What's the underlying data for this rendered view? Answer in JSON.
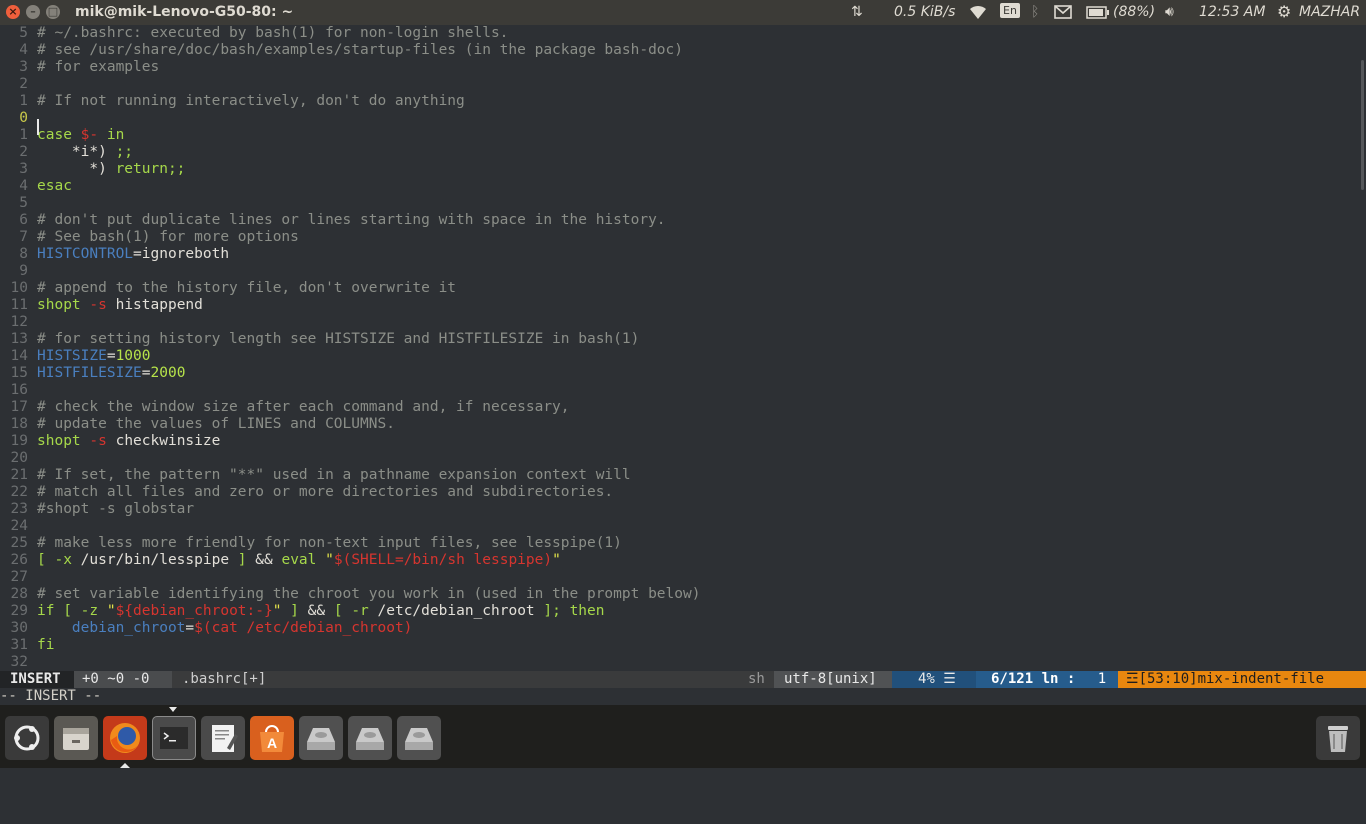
{
  "topbar": {
    "title": "mik@mik-Lenovo-G50-80: ~",
    "net_speed": "0.5 KiB/s",
    "keyboard": "En",
    "battery": "(88%)",
    "time": "12:53 AM",
    "user": "MAZHAR"
  },
  "editor": {
    "lines": [
      {
        "num": "5",
        "segs": [
          [
            "c",
            "# ~/.bashrc: executed by bash(1) for non-login shells."
          ]
        ]
      },
      {
        "num": "4",
        "segs": [
          [
            "c",
            "# see /usr/share/doc/bash/examples/startup-files (in the package bash-doc)"
          ]
        ]
      },
      {
        "num": "3",
        "segs": [
          [
            "c",
            "# for examples"
          ]
        ]
      },
      {
        "num": "2",
        "segs": []
      },
      {
        "num": "1",
        "segs": [
          [
            "c",
            "# If not running interactively, don't do anything"
          ]
        ]
      },
      {
        "num": "0",
        "cur": true,
        "segs": []
      },
      {
        "num": "1",
        "segs": [
          [
            "k",
            "case "
          ],
          [
            "r",
            "$-"
          ],
          [
            "k",
            " in"
          ]
        ]
      },
      {
        "num": "2",
        "segs": [
          [
            "wh",
            "    *i*) "
          ],
          [
            "k",
            ";;"
          ]
        ]
      },
      {
        "num": "3",
        "segs": [
          [
            "wh",
            "      *) "
          ],
          [
            "k",
            "return;;"
          ]
        ]
      },
      {
        "num": "4",
        "segs": [
          [
            "k",
            "esac"
          ]
        ]
      },
      {
        "num": "5",
        "segs": []
      },
      {
        "num": "6",
        "segs": [
          [
            "c",
            "# don't put duplicate lines or lines starting with space in the history."
          ]
        ]
      },
      {
        "num": "7",
        "segs": [
          [
            "c",
            "# See bash(1) for more options"
          ]
        ]
      },
      {
        "num": "8",
        "segs": [
          [
            "v",
            "HISTCONTROL"
          ],
          [
            "wh",
            "=ignoreboth"
          ]
        ]
      },
      {
        "num": "9",
        "segs": []
      },
      {
        "num": "10",
        "segs": [
          [
            "c",
            "# append to the history file, don't overwrite it"
          ]
        ]
      },
      {
        "num": "11",
        "segs": [
          [
            "k",
            "shopt "
          ],
          [
            "r",
            "-s"
          ],
          [
            "wh",
            " histappend"
          ]
        ]
      },
      {
        "num": "12",
        "segs": []
      },
      {
        "num": "13",
        "segs": [
          [
            "c",
            "# for setting history length see HISTSIZE and HISTFILESIZE in bash(1)"
          ]
        ]
      },
      {
        "num": "14",
        "segs": [
          [
            "v",
            "HISTSIZE"
          ],
          [
            "wh",
            "="
          ],
          [
            "n",
            "1000"
          ]
        ]
      },
      {
        "num": "15",
        "segs": [
          [
            "v",
            "HISTFILESIZE"
          ],
          [
            "wh",
            "="
          ],
          [
            "n",
            "2000"
          ]
        ]
      },
      {
        "num": "16",
        "segs": []
      },
      {
        "num": "17",
        "segs": [
          [
            "c",
            "# check the window size after each command and, if necessary,"
          ]
        ]
      },
      {
        "num": "18",
        "segs": [
          [
            "c",
            "# update the values of LINES and COLUMNS."
          ]
        ]
      },
      {
        "num": "19",
        "segs": [
          [
            "k",
            "shopt "
          ],
          [
            "r",
            "-s"
          ],
          [
            "wh",
            " checkwinsize"
          ]
        ]
      },
      {
        "num": "20",
        "segs": []
      },
      {
        "num": "21",
        "segs": [
          [
            "c",
            "# If set, the pattern \"**\" used in a pathname expansion context will"
          ]
        ]
      },
      {
        "num": "22",
        "segs": [
          [
            "c",
            "# match all files and zero or more directories and subdirectories."
          ]
        ]
      },
      {
        "num": "23",
        "segs": [
          [
            "c",
            "#shopt -s globstar"
          ]
        ]
      },
      {
        "num": "24",
        "segs": []
      },
      {
        "num": "25",
        "segs": [
          [
            "c",
            "# make less more friendly for non-text input files, see lesspipe(1)"
          ]
        ]
      },
      {
        "num": "26",
        "segs": [
          [
            "k",
            "[ -x "
          ],
          [
            "wh",
            "/usr/bin/lesspipe "
          ],
          [
            "k",
            "] "
          ],
          [
            "wh",
            "&& "
          ],
          [
            "k",
            "eval "
          ],
          [
            "y",
            "\""
          ],
          [
            "r",
            "$(SHELL=/bin/sh lesspipe)"
          ],
          [
            "y",
            "\""
          ]
        ]
      },
      {
        "num": "27",
        "segs": []
      },
      {
        "num": "28",
        "segs": [
          [
            "c",
            "# set variable identifying the chroot you work in (used in the prompt below)"
          ]
        ]
      },
      {
        "num": "29",
        "segs": [
          [
            "k",
            "if [ -z "
          ],
          [
            "y",
            "\""
          ],
          [
            "r",
            "${debian_chroot:-}"
          ],
          [
            "y",
            "\""
          ],
          [
            "k",
            " ] "
          ],
          [
            "wh",
            "&& "
          ],
          [
            "k",
            "[ -r "
          ],
          [
            "wh",
            "/etc/debian_chroot "
          ],
          [
            "k",
            "]; then"
          ]
        ]
      },
      {
        "num": "30",
        "segs": [
          [
            "wh",
            "    "
          ],
          [
            "v",
            "debian_chroot"
          ],
          [
            "wh",
            "="
          ],
          [
            "r",
            "$(cat /etc/debian_chroot)"
          ]
        ]
      },
      {
        "num": "31",
        "segs": [
          [
            "k",
            "fi"
          ]
        ]
      },
      {
        "num": "32",
        "segs": []
      }
    ]
  },
  "statusline": {
    "mode": "INSERT",
    "diff": "+0 ~0 -0",
    "filename": ".bashrc[+]",
    "filetype": "sh",
    "encoding": "utf-8[unix]",
    "percent": "4%",
    "position": "6/121",
    "ln": "ln",
    "col": "1",
    "warning": "[53:10]mix-indent-file"
  },
  "cmdline": "-- INSERT --",
  "dock": {
    "items": [
      "ubuntu-logo",
      "files",
      "firefox",
      "terminal",
      "text-editor",
      "software-center",
      "drive",
      "drive",
      "drive",
      "trash"
    ]
  }
}
